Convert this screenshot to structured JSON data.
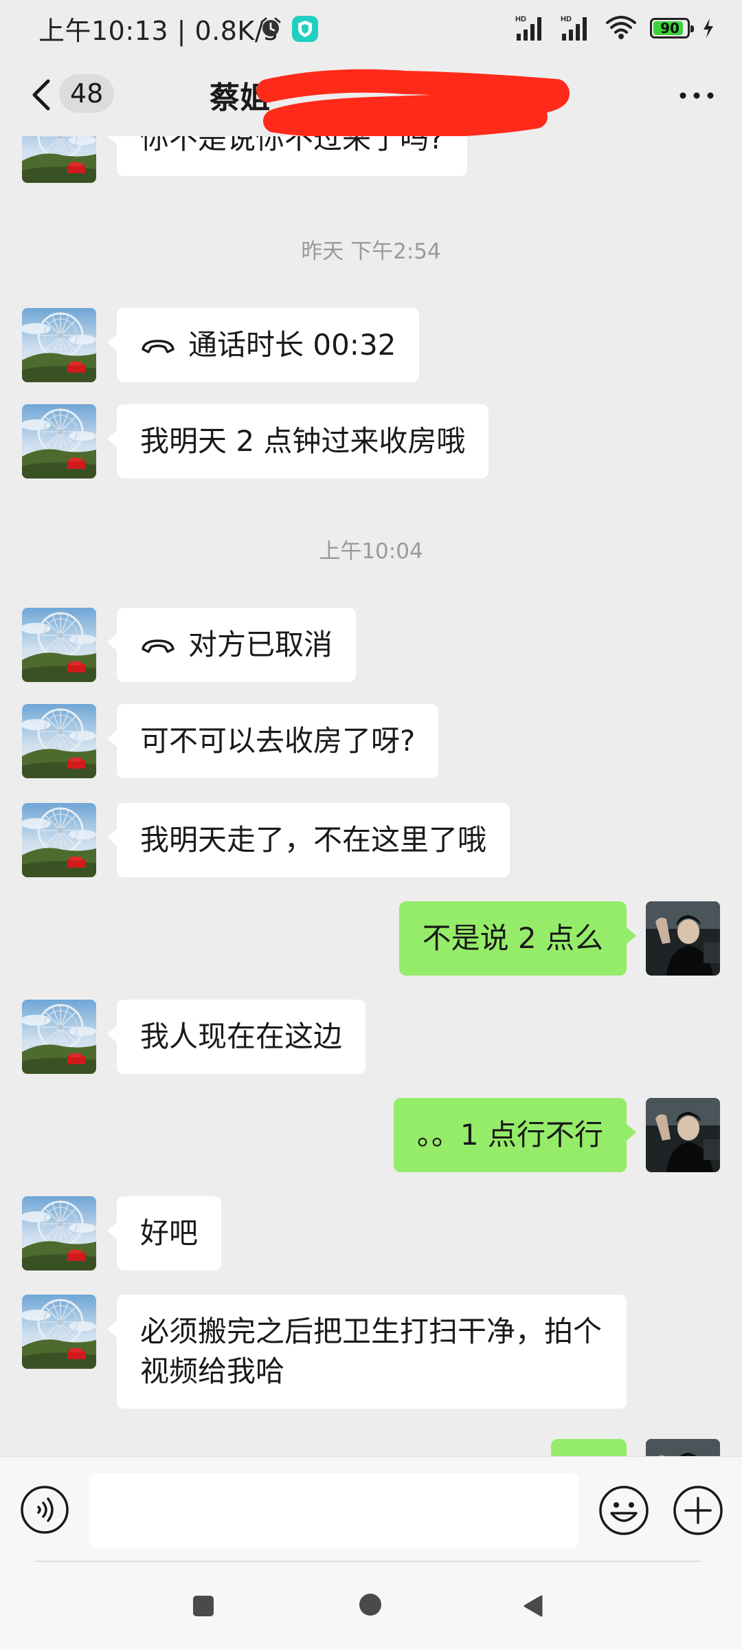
{
  "status_bar": {
    "time_speed": "上午10:13 | 0.8K/s",
    "alarm_icon": "alarm-clock-icon",
    "app_icon": "shield-app-icon",
    "signal_1_label": "HD",
    "signal_2_label": "HD",
    "battery": "90",
    "battery_level": 0.9,
    "battery_color": "#3ad33a"
  },
  "header": {
    "back_icon": "chevron-left-icon",
    "unread_count": "48",
    "title": "蔡姐",
    "more_icon": "ellipsis-icon"
  },
  "messages": {
    "m0": "你不是说你不过来了吗?",
    "ts1": "昨天 下午2:54",
    "m1": "通话时长 00:32",
    "m2": "我明天 2 点钟过来收房哦",
    "ts2": "上午10:04",
    "m3": "对方已取消",
    "m4": "可不可以去收房了呀?",
    "m5": "我明天走了，不在这里了哦",
    "m6": "不是说 2 点么",
    "m7": "我人现在在这边",
    "m8": "。。1 点行不行",
    "m9": "好吧",
    "m10": "必须搬完之后把卫生打扫干净，拍个视频给我哈"
  },
  "input_bar": {
    "voice_icon": "voice-input-icon",
    "emoji_icon": "emoji-icon",
    "plus_icon": "plus-icon",
    "input_value": ""
  },
  "system_nav": {
    "recents_icon": "square-icon",
    "home_icon": "circle-icon",
    "back_icon": "triangle-back-icon"
  },
  "colors": {
    "background": "#ededed",
    "incoming_bubble": "#ffffff",
    "outgoing_bubble": "#95ec69",
    "redaction": "#ff2a1a"
  }
}
